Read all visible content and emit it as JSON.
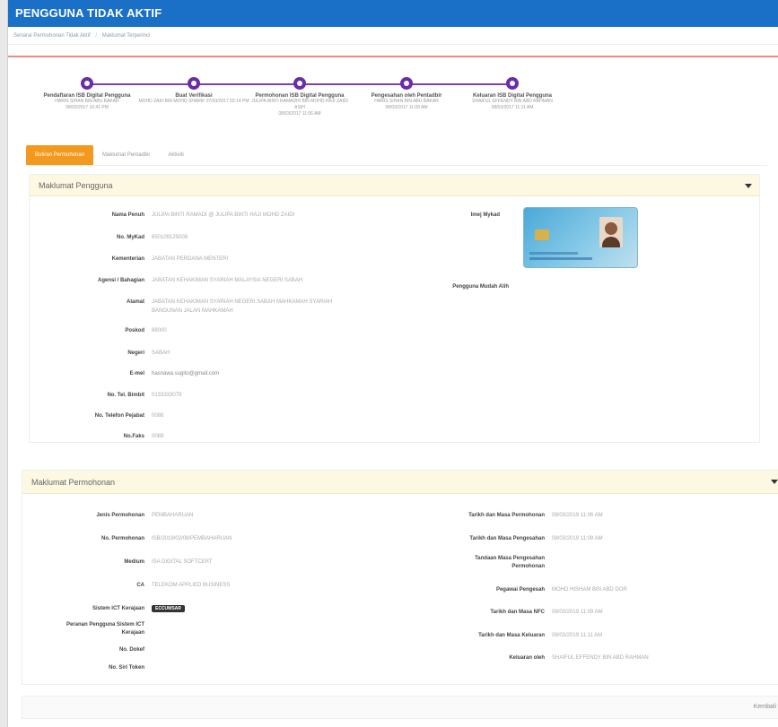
{
  "window": {
    "title": "PENGGUNA TIDAK AKTIF"
  },
  "breadcrumb": {
    "items": [
      "Senarai Permohonan Tidak Aktif",
      "Maklumat Terperinci"
    ]
  },
  "steps": [
    {
      "title": "Pendaftaran ISB Digital Pengguna",
      "sub1": "HARIS SIHAN BIN ABU BAKAR",
      "sub2": "08/03/2017 10:41 PM"
    },
    {
      "title": "Buat Verifikasi",
      "sub1": "MOHD ZAKI BIN MOHD SHARIF 07/03/2017 03:14 PM",
      "sub2": ""
    },
    {
      "title": "Permohonan ISB Digital Pengguna",
      "sub1": "JULIPA BINTI RAMADHI BIN MOHD HAJI ZAIDI",
      "sub2": "ASIH",
      "sub3": "08/03/2017 11:06 AM"
    },
    {
      "title": "Pengesahan oleh Pentadbir",
      "sub1": "HARIS SIHAN BIN ABU BAKAR",
      "sub2": "08/03/2017 11:09 AM"
    },
    {
      "title": "Keluaran ISB Digital Pengguna",
      "sub1": "SHAIFUL EFFENDY BIN ABD RAHMAN",
      "sub2": "08/03/2017 11:11 AM"
    }
  ],
  "tabs": [
    "Butiran Permohonan",
    "Maklumat Pentadbir",
    "Aktiviti"
  ],
  "pengguna": {
    "heading": "Maklumat Pengguna",
    "fields": [
      {
        "label": "Nama Penuh",
        "value": "JULIPA BINTI RAMADI @ JULIPA BINTI HAJI MOHD ZAIDI"
      },
      {
        "label": "No. MyKad",
        "value": "650109125008"
      },
      {
        "label": "Kementerian",
        "value": "JABATAN PERDANA MENTERI"
      },
      {
        "label": "Agensi / Bahagian",
        "value": "JABATAN KEHAKIMAN SYARIAH MALAYSIA NEGERI SABAH"
      },
      {
        "label": "Alamat",
        "value": "JABATAN KEHAKIMAN SYARIAH NEGERI SABAH MAHKAMAH SYARIAH",
        "value2": "BANGUNAN JALAN MAHKAMAH"
      },
      {
        "label": "Poskod",
        "value": "88000"
      },
      {
        "label": "Negeri",
        "value": "SABAH"
      },
      {
        "label": "E-mel",
        "value": "hasnawa.sugito@gmail.com"
      },
      {
        "label": "No. Tel. Bimbit",
        "value": "0133333079"
      },
      {
        "label": "No. Telefon Pejabat",
        "value": "0088"
      },
      {
        "label": "No.Faks",
        "value": "0088"
      }
    ],
    "mykad_label": "Imej Mykad",
    "pengguna_label": "Pengguna Mudah Alih"
  },
  "permohonan": {
    "heading": "Maklumat Permohonan",
    "left": [
      {
        "label": "Jenis Permohonan",
        "value": "PEMBAHARUAN"
      },
      {
        "label": "No. Permohonan",
        "value": "ISB/2019/02/08/PEMBAHARUAN"
      },
      {
        "label": "Medium",
        "value": "ISA DIGITAL SOFTCERT"
      },
      {
        "label": "CA",
        "value": "TELEKOM APPLIED BUSINESS"
      },
      {
        "label": "Sistem ICT Kerajaan",
        "value": ""
      },
      {
        "label": "Peranan Pengguna Sistem ICT",
        "label2": "Kerajaan",
        "value": ""
      },
      {
        "label": "No. Dokef",
        "value": ""
      },
      {
        "label": "No. Siri Token",
        "value": ""
      }
    ],
    "system_badge": "ECCUMSAR",
    "right": [
      {
        "label": "Tarikh dan Masa Permohonan",
        "value": "08/03/2019 11:06 AM"
      },
      {
        "label": "Tarikh dan Masa Pengesahan",
        "value": "08/03/2019 11:09 AM"
      },
      {
        "label": "Tandaan Masa Pengesahan",
        "label2": "Permohonan",
        "value": ""
      },
      {
        "label": "Pegawai Pengesah",
        "value": "MOHD HISHAM BIN ABD DOR"
      },
      {
        "label": "Tarikh dan Masa NFC",
        "value": "08/03/2019 11:09 AM"
      },
      {
        "label": "Tarikh dan Masa Keluaran",
        "value": "08/03/2019 11:11 AM"
      },
      {
        "label": "Keluaran oleh",
        "value": "SHAIFUL EFFENDY BIN ABD RAHMAN"
      }
    ]
  },
  "footer": {
    "back_label": "Kembali"
  }
}
